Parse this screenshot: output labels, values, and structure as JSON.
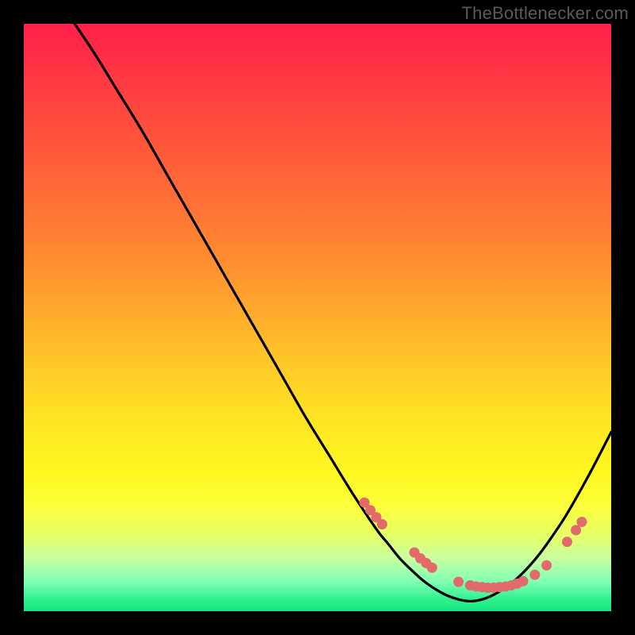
{
  "watermark": "TheBottlenecker.com",
  "colors": {
    "background": "#000000",
    "curve_stroke": "#000000",
    "marker_fill": "#e26a6a",
    "marker_stroke": "#c95858"
  },
  "chart_data": {
    "type": "line",
    "title": "",
    "xlabel": "",
    "ylabel": "",
    "xlim": [
      0,
      100
    ],
    "ylim": [
      0,
      100
    ],
    "x": [
      0,
      4,
      8,
      12,
      16,
      20,
      24,
      28,
      32,
      36,
      40,
      44,
      48,
      52,
      56,
      60,
      62,
      64,
      66,
      68,
      70,
      72,
      74,
      76,
      78,
      80,
      82,
      84,
      86,
      88,
      90,
      92,
      94,
      96,
      98,
      100
    ],
    "values": [
      112,
      107,
      101,
      95,
      88.5,
      82,
      75,
      68,
      61,
      54,
      47,
      40,
      33,
      26.5,
      20,
      14,
      11.5,
      9,
      7,
      5.2,
      3.8,
      2.7,
      2,
      1.7,
      2,
      2.8,
      4,
      5.6,
      7.6,
      10,
      12.8,
      15.8,
      19.2,
      22.8,
      26.6,
      30.5
    ],
    "markers": [
      {
        "x": 58,
        "y": 18.5
      },
      {
        "x": 59,
        "y": 17.2
      },
      {
        "x": 60,
        "y": 16.0
      },
      {
        "x": 61,
        "y": 14.8
      },
      {
        "x": 66.5,
        "y": 10.0
      },
      {
        "x": 67.5,
        "y": 9.0
      },
      {
        "x": 68.5,
        "y": 8.2
      },
      {
        "x": 69.5,
        "y": 7.4
      },
      {
        "x": 74,
        "y": 5.0
      },
      {
        "x": 76,
        "y": 4.4
      },
      {
        "x": 77,
        "y": 4.2
      },
      {
        "x": 78,
        "y": 4.1
      },
      {
        "x": 79,
        "y": 4.0
      },
      {
        "x": 80,
        "y": 4.0
      },
      {
        "x": 81,
        "y": 4.1
      },
      {
        "x": 82,
        "y": 4.2
      },
      {
        "x": 83,
        "y": 4.4
      },
      {
        "x": 84,
        "y": 4.7
      },
      {
        "x": 85,
        "y": 5.1
      },
      {
        "x": 87,
        "y": 6.2
      },
      {
        "x": 89,
        "y": 7.8
      },
      {
        "x": 92.5,
        "y": 11.8
      },
      {
        "x": 94,
        "y": 13.8
      },
      {
        "x": 95,
        "y": 15.2
      }
    ]
  }
}
